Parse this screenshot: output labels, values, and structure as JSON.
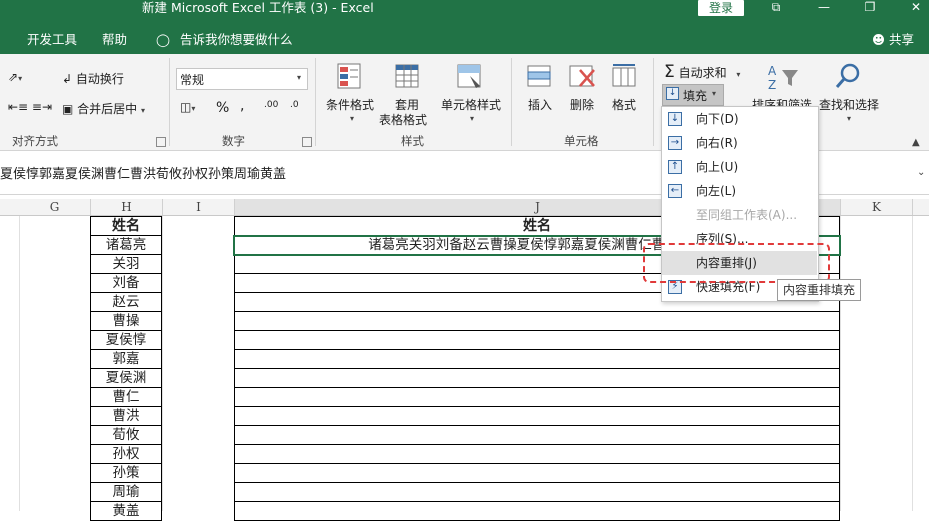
{
  "window": {
    "title": "新建 Microsoft Excel 工作表 (3)  -  Excel",
    "login_label": "登录"
  },
  "tabs": [
    "开发工具",
    "帮助",
    "告诉我你想要做什么",
    "共享"
  ],
  "ribbon": {
    "alignment": {
      "wrap_label": "自动换行",
      "merge_label": "合并后居中",
      "group_label": "对齐方式"
    },
    "number": {
      "format_value": "常规",
      "group_label": "数字"
    },
    "styles": {
      "conditional_label": "条件格式",
      "table_label_1": "套用",
      "table_label_2": "表格格式",
      "cell_styles_label": "单元格样式",
      "group_label": "样式"
    },
    "cells": {
      "insert_label": "插入",
      "delete_label": "删除",
      "format_label": "格式",
      "group_label": "单元格"
    },
    "editing": {
      "autosum_label": "自动求和",
      "fill_label": "填充",
      "sort_label": "排序和筛选",
      "find_label": "查找和选择"
    }
  },
  "formula_bar": {
    "value": "夏侯惇郭嘉夏侯渊曹仁曹洪荀攸孙权孙策周瑜黄盖"
  },
  "columns": [
    "G",
    "H",
    "I",
    "J",
    "K"
  ],
  "sheet": {
    "h_header": "姓名",
    "h_values": [
      "诸葛亮",
      "关羽",
      "刘备",
      "赵云",
      "曹操",
      "夏侯惇",
      "郭嘉",
      "夏侯渊",
      "曹仁",
      "曹洪",
      "荀攸",
      "孙权",
      "孙策",
      "周瑜",
      "黄盖"
    ],
    "j_header": "姓名",
    "j_first": "诸葛亮关羽刘备赵云曹操夏侯惇郭嘉夏侯渊曹仁曹洪荀攸"
  },
  "fill_menu": {
    "items": [
      {
        "label": "向下(D)",
        "icon": "arrow-down-icon",
        "enabled": true
      },
      {
        "label": "向右(R)",
        "icon": "arrow-right-icon",
        "enabled": true
      },
      {
        "label": "向上(U)",
        "icon": "arrow-up-icon",
        "enabled": true
      },
      {
        "label": "向左(L)",
        "icon": "arrow-left-icon",
        "enabled": true
      },
      {
        "label": "至同组工作表(A)...",
        "icon": "",
        "enabled": false
      },
      {
        "label": "序列(S)...",
        "icon": "",
        "enabled": true
      },
      {
        "label": "内容重排(J)",
        "icon": "",
        "enabled": true,
        "highlighted": true
      },
      {
        "label": "快速填充(F)",
        "icon": "flash-fill-icon",
        "enabled": true
      }
    ],
    "tooltip": "内容重排填充"
  },
  "colors": {
    "excel_green": "#217346",
    "highlight_box": "#e03a3a"
  }
}
